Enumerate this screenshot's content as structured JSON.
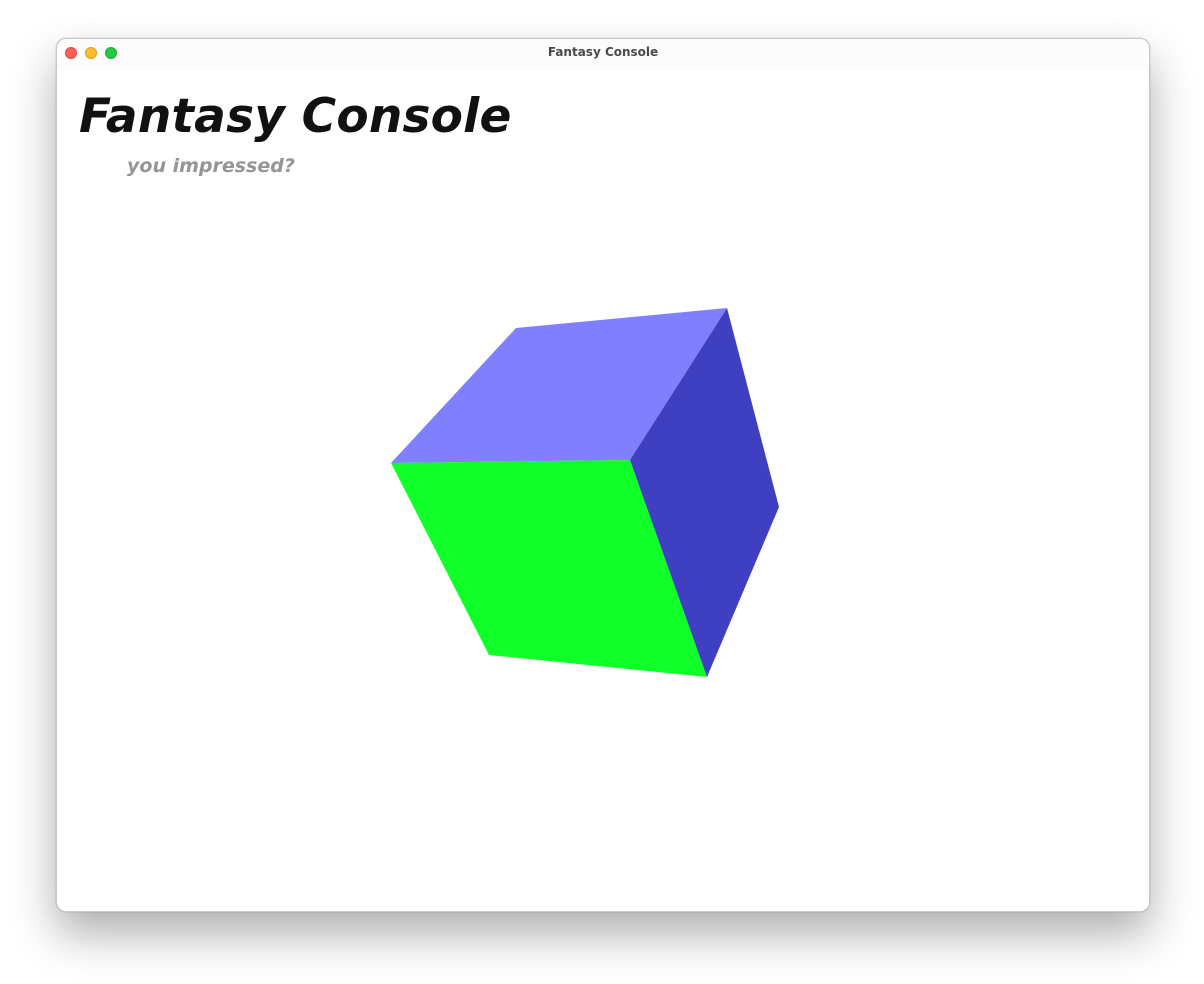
{
  "window": {
    "title": "Fantasy Console"
  },
  "header": {
    "title": "Fantasy Console",
    "subtitle": "you impressed?"
  },
  "scene": {
    "object": "cube",
    "faces": {
      "top": "#8080ff",
      "front": "#10ff28",
      "side": "#3f3fc2"
    }
  }
}
